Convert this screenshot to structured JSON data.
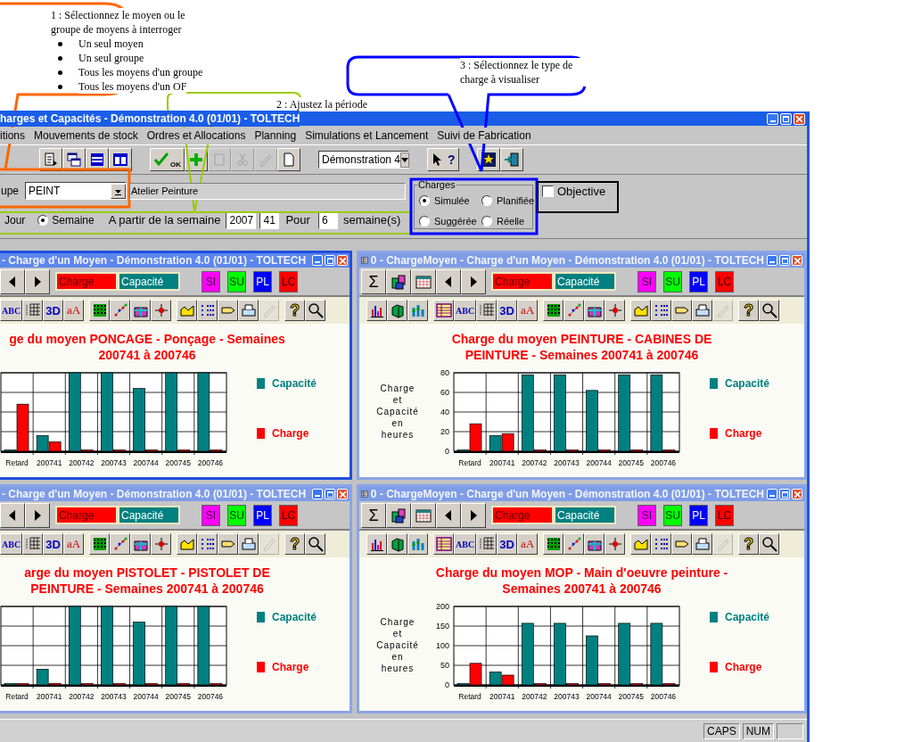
{
  "annotations": [
    {
      "text": "1 : Sélectionnez le moyen ou le groupe de moyens à interroger",
      "bullets": [
        "Un seul moyen",
        "Un seul groupe",
        "Tous les moyens d'un groupe",
        "Tous les moyens d'un OF"
      ]
    },
    {
      "text": "2 : Ajustez la période"
    },
    {
      "text": "3 : Sélectionnez le type de charge à visualiser"
    }
  ],
  "window": {
    "title": "harges et Capacités - Démonstration 4.0 (01/01) - TOLTECH"
  },
  "menu": [
    "itions",
    "Mouvements de stock",
    "Ordres et Allocations",
    "Planning",
    "Simulations et Lancement",
    "Suivi de Fabrication"
  ],
  "toolbar": [
    [
      {
        "kind": "copy",
        "disabled": false
      },
      {
        "kind": "windows",
        "disabled": false
      },
      {
        "kind": "list",
        "disabled": false
      },
      {
        "kind": "columns",
        "disabled": false
      }
    ],
    [
      {
        "kind": "ok",
        "label": "OK",
        "disabled": false
      },
      {
        "kind": "plus",
        "disabled": false
      },
      {
        "kind": "blank",
        "disabled": true
      },
      {
        "kind": "cut",
        "disabled": true
      },
      {
        "kind": "pen",
        "disabled": true
      },
      {
        "kind": "page",
        "disabled": false
      }
    ],
    [
      {
        "kind": "combo",
        "value": "Démonstration 4",
        "disabled": false
      }
    ],
    [
      {
        "kind": "pointer-help",
        "label": "?",
        "disabled": false
      }
    ],
    [
      {
        "kind": "chart",
        "disabled": false
      },
      {
        "kind": "exit",
        "disabled": false
      }
    ]
  ],
  "group_row": {
    "label": "upe",
    "value": "PEINT",
    "description": "Atelier Peinture"
  },
  "charges": {
    "legend": "Charges",
    "options": [
      {
        "label": "Simulée",
        "selected": true
      },
      {
        "label": "Planifiée",
        "selected": false
      },
      {
        "label": "Suggérée",
        "selected": false
      },
      {
        "label": "Réelle",
        "selected": false
      }
    ]
  },
  "objective": {
    "label": "Objective",
    "checked": false
  },
  "period": {
    "cut_label": "Jour",
    "unit": {
      "label": "Semaine",
      "selected": true
    },
    "from_label": "A partir de la semaine",
    "year": "2007",
    "week": "41",
    "for_label": "Pour",
    "count": "6",
    "count_unit": "semaine(s)"
  },
  "child_windows": [
    {
      "title": "- Charge d'un Moyen - Démonstration 4.0 (01/01) - TOLTECH",
      "active": true,
      "cropped": true,
      "tools": [
        {
          "kind": "prev"
        },
        {
          "kind": "next"
        }
      ],
      "fields": [
        {
          "label": "Charge",
          "color": "#ff0000"
        },
        {
          "label": "Capacité",
          "color": "#008080"
        }
      ],
      "modes": [
        {
          "label": "SI",
          "color": "#ff00ff"
        },
        {
          "label": "SU",
          "color": "#00ff00"
        },
        {
          "label": "PL",
          "color": "#0000ff"
        },
        {
          "label": "LC",
          "color": "#ff0000"
        }
      ],
      "chart_tools": [
        [
          {
            "kind": "abc",
            "label": "ABC",
            "disabled": false
          },
          {
            "kind": "grid",
            "disabled": false
          },
          {
            "kind": "perspective",
            "label": "3D",
            "disabled": false
          },
          {
            "kind": "font",
            "label": "aA",
            "disabled": false
          }
        ],
        [
          {
            "kind": "pattern",
            "disabled": false
          },
          {
            "kind": "points",
            "disabled": false
          },
          {
            "kind": "gift",
            "disabled": false
          },
          {
            "kind": "cross",
            "disabled": false
          }
        ],
        [
          {
            "kind": "area",
            "disabled": false
          },
          {
            "kind": "legend",
            "disabled": false
          },
          {
            "kind": "tag",
            "disabled": false
          },
          {
            "kind": "printer",
            "disabled": false
          },
          {
            "kind": "pen",
            "disabled": true
          }
        ],
        [
          {
            "kind": "help",
            "label": "?",
            "disabled": false
          },
          {
            "kind": "zoom",
            "disabled": false
          }
        ]
      ],
      "chart_title": [
        "ge du moyen PONCAGE - Ponçage - Semaines",
        "200741 à 200746"
      ],
      "x_labels": [
        "Retard",
        "200741",
        "200742",
        "200743",
        "200744",
        "200745",
        "200746"
      ],
      "legend": [
        {
          "name": "Capacité",
          "color": "#008080"
        },
        {
          "name": "Charge",
          "color": "#ff0000"
        }
      ]
    },
    {
      "title": "0 - ChargeMoyen - Charge d'un Moyen - Démonstration 4.0 (01/01) - TOLTECH",
      "active": false,
      "cropped": false,
      "tools": [
        {
          "kind": "sigma",
          "label": "Σ"
        },
        {
          "kind": "db"
        },
        {
          "kind": "calendar"
        },
        {
          "kind": "prev"
        },
        {
          "kind": "next"
        }
      ],
      "fields": [
        {
          "label": "Charge",
          "color": "#ff0000"
        },
        {
          "label": "Capacité",
          "color": "#008080"
        }
      ],
      "modes": [
        {
          "label": "SI",
          "color": "#ff00ff"
        },
        {
          "label": "SU",
          "color": "#00ff00"
        },
        {
          "label": "PL",
          "color": "#0000ff"
        },
        {
          "label": "LC",
          "color": "#ff0000"
        }
      ],
      "chart_tools": [
        [
          {
            "kind": "bars",
            "disabled": false
          },
          {
            "kind": "cube",
            "disabled": false
          },
          {
            "kind": "stack",
            "disabled": false
          }
        ],
        [
          {
            "kind": "table",
            "disabled": false
          },
          {
            "kind": "abc",
            "label": "ABC",
            "disabled": false
          },
          {
            "kind": "grid",
            "disabled": false
          },
          {
            "kind": "perspective",
            "label": "3D",
            "disabled": false
          },
          {
            "kind": "font",
            "label": "aA",
            "disabled": false
          }
        ],
        [
          {
            "kind": "pattern",
            "disabled": false
          },
          {
            "kind": "points",
            "disabled": false
          },
          {
            "kind": "gift",
            "disabled": false
          },
          {
            "kind": "cross",
            "disabled": false
          }
        ],
        [
          {
            "kind": "area",
            "disabled": false
          },
          {
            "kind": "legend",
            "disabled": false
          },
          {
            "kind": "tag",
            "disabled": false
          },
          {
            "kind": "printer",
            "disabled": false
          },
          {
            "kind": "pen",
            "disabled": true
          }
        ],
        [
          {
            "kind": "help",
            "label": "?",
            "disabled": false
          },
          {
            "kind": "zoom",
            "disabled": false
          }
        ]
      ],
      "chart_title": [
        "Charge du moyen PEINTURE - CABINES DE",
        "PEINTURE - Semaines 200741 à 200746"
      ],
      "chart_data": {
        "type": "bar",
        "grid": true,
        "ylabel": "Charge et Capacité en heures",
        "categories": [
          "Retard",
          "200741",
          "200742",
          "200743",
          "200744",
          "200745",
          "200746"
        ],
        "ylim": [
          0,
          80
        ],
        "yticks": [
          0,
          20,
          40,
          60,
          80
        ],
        "series": [
          {
            "name": "Capacité",
            "color": "#008080",
            "values": [
              0,
              16,
              78,
              78,
              62,
              78,
              78
            ]
          },
          {
            "name": "Charge",
            "color": "#ff0000",
            "values": [
              28,
              18,
              0,
              0,
              0,
              0,
              0
            ]
          }
        ]
      }
    },
    {
      "title": "- Charge d'un Moyen - Démonstration 4.0 (01/01) - TOLTECH",
      "active": false,
      "cropped": true,
      "tools": [
        {
          "kind": "prev"
        },
        {
          "kind": "next"
        }
      ],
      "fields": [
        {
          "label": "Charge",
          "color": "#ff0000"
        },
        {
          "label": "Capacité",
          "color": "#008080"
        }
      ],
      "modes": [
        {
          "label": "SI",
          "color": "#ff00ff"
        },
        {
          "label": "SU",
          "color": "#00ff00"
        },
        {
          "label": "PL",
          "color": "#0000ff"
        },
        {
          "label": "LC",
          "color": "#ff0000"
        }
      ],
      "chart_tools": [
        [
          {
            "kind": "abc",
            "label": "ABC",
            "disabled": false
          },
          {
            "kind": "grid",
            "disabled": false
          },
          {
            "kind": "perspective",
            "label": "3D",
            "disabled": false
          },
          {
            "kind": "font",
            "label": "aA",
            "disabled": false
          }
        ],
        [
          {
            "kind": "pattern",
            "disabled": false
          },
          {
            "kind": "points",
            "disabled": false
          },
          {
            "kind": "gift",
            "disabled": false
          },
          {
            "kind": "cross",
            "disabled": false
          }
        ],
        [
          {
            "kind": "area",
            "disabled": false
          },
          {
            "kind": "legend",
            "disabled": false
          },
          {
            "kind": "tag",
            "disabled": false
          },
          {
            "kind": "printer",
            "disabled": false
          },
          {
            "kind": "pen",
            "disabled": true
          }
        ],
        [
          {
            "kind": "help",
            "label": "?",
            "disabled": false
          },
          {
            "kind": "zoom",
            "disabled": false
          }
        ]
      ],
      "chart_title": [
        "arge du moyen PISTOLET - PISTOLET DE",
        "PEINTURE - Semaines 200741 à 200746"
      ],
      "x_labels": [
        "Retard",
        "200741",
        "200742",
        "200743",
        "200744",
        "200745",
        "200746"
      ],
      "legend": [
        {
          "name": "Capacité",
          "color": "#008080"
        },
        {
          "name": "Charge",
          "color": "#ff0000"
        }
      ]
    },
    {
      "title": "0 - ChargeMoyen - Charge d'un Moyen - Démonstration 4.0 (01/01) - TOLTECH",
      "active": false,
      "cropped": false,
      "tools": [
        {
          "kind": "sigma",
          "label": "Σ"
        },
        {
          "kind": "db"
        },
        {
          "kind": "calendar"
        },
        {
          "kind": "prev"
        },
        {
          "kind": "next"
        }
      ],
      "fields": [
        {
          "label": "Charge",
          "color": "#ff0000"
        },
        {
          "label": "Capacité",
          "color": "#008080"
        }
      ],
      "modes": [
        {
          "label": "SI",
          "color": "#ff00ff"
        },
        {
          "label": "SU",
          "color": "#00ff00"
        },
        {
          "label": "PL",
          "color": "#0000ff"
        },
        {
          "label": "LC",
          "color": "#ff0000"
        }
      ],
      "chart_tools": [
        [
          {
            "kind": "bars",
            "disabled": false
          },
          {
            "kind": "cube",
            "disabled": false
          },
          {
            "kind": "stack",
            "disabled": false
          }
        ],
        [
          {
            "kind": "table",
            "disabled": false
          },
          {
            "kind": "abc",
            "label": "ABC",
            "disabled": false
          },
          {
            "kind": "grid",
            "disabled": false
          },
          {
            "kind": "perspective",
            "label": "3D",
            "disabled": false
          },
          {
            "kind": "font",
            "label": "aA",
            "disabled": false
          }
        ],
        [
          {
            "kind": "pattern",
            "disabled": false
          },
          {
            "kind": "points",
            "disabled": false
          },
          {
            "kind": "gift",
            "disabled": false
          },
          {
            "kind": "cross",
            "disabled": false
          }
        ],
        [
          {
            "kind": "area",
            "disabled": false
          },
          {
            "kind": "legend",
            "disabled": false
          },
          {
            "kind": "tag",
            "disabled": false
          },
          {
            "kind": "printer",
            "disabled": false
          },
          {
            "kind": "pen",
            "disabled": true
          }
        ],
        [
          {
            "kind": "help",
            "label": "?",
            "disabled": false
          },
          {
            "kind": "zoom",
            "disabled": false
          }
        ]
      ],
      "chart_title": [
        "Charge du moyen MOP - Main d'oeuvre peinture -",
        "Semaines 200741 à 200746"
      ],
      "chart_data": {
        "type": "bar",
        "grid": true,
        "ylabel": "Charge et Capacité en heures",
        "categories": [
          "Retard",
          "200741",
          "200742",
          "200743",
          "200744",
          "200745",
          "200746"
        ],
        "ylim": [
          0,
          200
        ],
        "yticks": [
          0,
          50,
          100,
          150,
          200
        ],
        "series": [
          {
            "name": "Capacité",
            "color": "#008080",
            "values": [
              0,
              33,
              157,
              157,
              125,
              157,
              157
            ]
          },
          {
            "name": "Charge",
            "color": "#ff0000",
            "values": [
              55,
              25,
              0,
              0,
              0,
              0,
              0
            ]
          }
        ]
      }
    }
  ],
  "status_bar": [
    "CAPS",
    "NUM"
  ]
}
